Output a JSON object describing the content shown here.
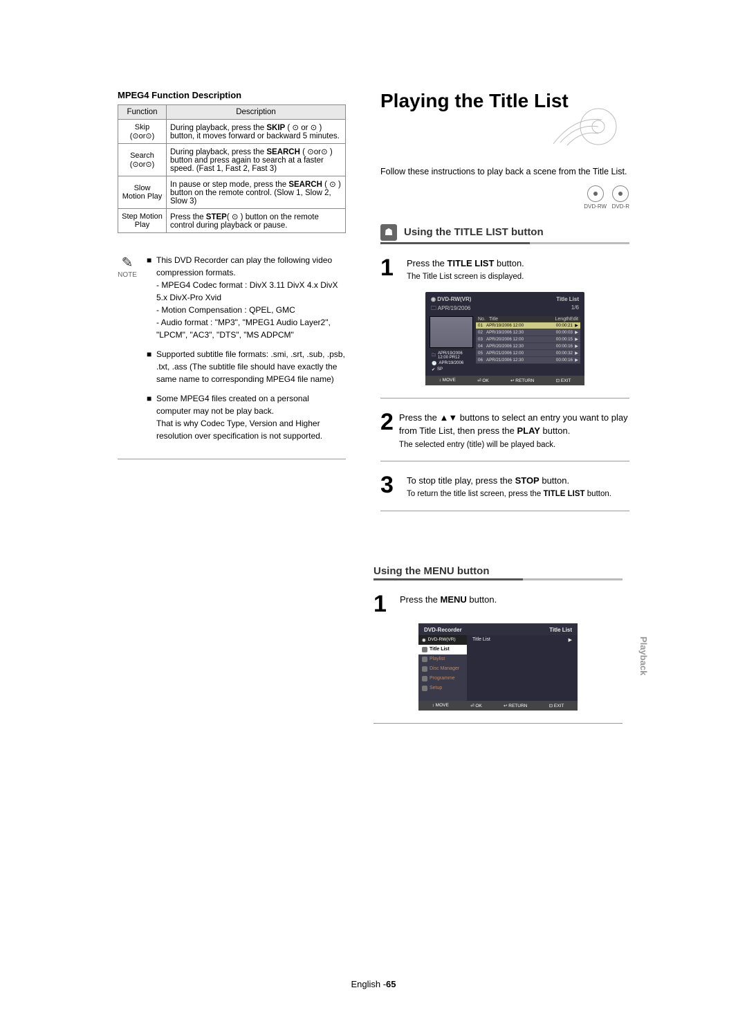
{
  "left": {
    "table_title": "MPEG4 Function Description",
    "headers": [
      "Function",
      "Description"
    ],
    "rows": [
      {
        "fn": "Skip",
        "sub": "(⊙or⊙)",
        "desc_pre": "During playback, press the ",
        "desc_bold": "SKIP",
        "desc_mid": " ( ⊙ or ⊙ ) button, it moves forward or backward 5 minutes."
      },
      {
        "fn": "Search",
        "sub": "(⊙or⊙)",
        "desc_pre": "During playback, press the ",
        "desc_bold": "SEARCH",
        "desc_mid": " ( ⊙or⊙ ) button and press again to search at a faster speed. (Fast 1, Fast 2, Fast 3)"
      },
      {
        "fn": "Slow Motion Play",
        "sub": "",
        "desc_pre": "In pause or step mode, press the ",
        "desc_bold": "SEARCH",
        "desc_mid": " ( ⊙ ) button on the remote control. (Slow 1, Slow 2, Slow 3)"
      },
      {
        "fn": "Step Motion Play",
        "sub": "",
        "desc_pre": "Press the ",
        "desc_bold": "STEP",
        "desc_mid": "( ⊙ ) button on the remote control during playback or pause."
      }
    ],
    "note_label": "NOTE",
    "note1_intro": "This DVD Recorder can play the following video compression formats.",
    "note1_a": "- MPEG4 Codec format : DivX 3.11 DivX 4.x DivX 5.x DivX-Pro Xvid",
    "note1_b": "- Motion Compensation : QPEL, GMC",
    "note1_c": "- Audio format : \"MP3\", \"MPEG1 Audio Layer2\", \"LPCM\", \"AC3\", \"DTS\", \"MS ADPCM\"",
    "note2": "Supported subtitle file formats: .smi, .srt, .sub, .psb, .txt, .ass (The subtitle file should have exactly the same name to corresponding MPEG4 file name)",
    "note3": "Some MPEG4 files created on a personal computer may not be play back.\nThat is why Codec Type, Version and Higher resolution over specification is not supported."
  },
  "right": {
    "hero": "Playing the Title List",
    "intro": "Follow these instructions to play back a scene from the Title List.",
    "discs": [
      "DVD-RW",
      "DVD-R"
    ],
    "sub1": "Using the TITLE LIST button",
    "step1_pre": "Press the ",
    "step1_bold": "TITLE LIST",
    "step1_post": " button.",
    "step1_sub": "The Title List screen is displayed.",
    "osd1": {
      "disc": "DVD-RW(VR)",
      "title": "Title List",
      "count": "1/6",
      "date": "APR/19/2006",
      "cols": [
        "No.",
        "Title",
        "Length",
        "Edit"
      ],
      "side": [
        "APR/19/2006 12:00 PR12",
        "APR/19/2006",
        "SP"
      ],
      "rows": [
        {
          "n": "01",
          "t": "APR/19/2006 12:00",
          "len": "00:00:21",
          "play": "▶",
          "sel": true
        },
        {
          "n": "02",
          "t": "APR/19/2006 12:30",
          "len": "00:00:03",
          "play": "▶"
        },
        {
          "n": "03",
          "t": "APR/20/2006 12:00",
          "len": "00:00:15",
          "play": "▶"
        },
        {
          "n": "04",
          "t": "APR/20/2006 12:30",
          "len": "00:00:16",
          "play": "▶"
        },
        {
          "n": "05",
          "t": "APR/21/2006 12:00",
          "len": "00:00:32",
          "play": "▶"
        },
        {
          "n": "06",
          "t": "APR/21/2006 12:30",
          "len": "00:00:16",
          "play": "▶"
        }
      ],
      "bar": [
        "↕ MOVE",
        "⏎ OK",
        "↩ RETURN",
        "⊡ EXIT"
      ]
    },
    "step2_text": "Press the ▲▼ buttons to select an entry you want to play from Title List, then press the ",
    "step2_bold": "PLAY",
    "step2_post": " button.",
    "step2_sub": "The selected entry (title) will be played back.",
    "step3_pre": "To stop title play, press the ",
    "step3_bold": "STOP",
    "step3_post": " button.",
    "step3_sub_pre": "To return the title list screen, press the ",
    "step3_sub_bold": "TITLE LIST",
    "step3_sub_post": " button."
  },
  "menu": {
    "sub": "Using the MENU button",
    "step1_pre": "Press the ",
    "step1_bold": "MENU",
    "step1_post": " button.",
    "osd": {
      "top_l": "DVD-Recorder",
      "top_r": "Title List",
      "status": "DVD-RW(VR)",
      "items": [
        {
          "label": "Title List",
          "sel": true
        },
        {
          "label": "Playlist",
          "dim": true
        },
        {
          "label": "Disc Manager",
          "dim": true
        },
        {
          "label": "Programme",
          "dim": true
        },
        {
          "label": "Setup",
          "dim": true
        }
      ],
      "crumb": "Title List",
      "arrow": "▶",
      "bar": [
        "↕ MOVE",
        "⏎ OK",
        "↩ RETURN",
        "⊡ EXIT"
      ]
    }
  },
  "sidetab": "Playback",
  "page_lang": "English -",
  "page_num": "65"
}
